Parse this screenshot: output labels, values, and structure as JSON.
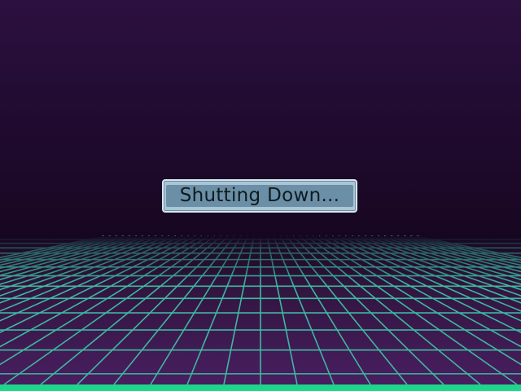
{
  "dialog": {
    "message": "Shutting Down..."
  },
  "colors": {
    "sky_top": "#2c1040",
    "sky_bottom": "#150620",
    "grid_line": "#3fb8a0",
    "grid_cell": "#4a1f62",
    "floor_bar": "#1fd58a",
    "dialog_border": "#d7e7f1",
    "dialog_fill": "#6b8fa6",
    "dialog_text": "#0f1a20"
  }
}
